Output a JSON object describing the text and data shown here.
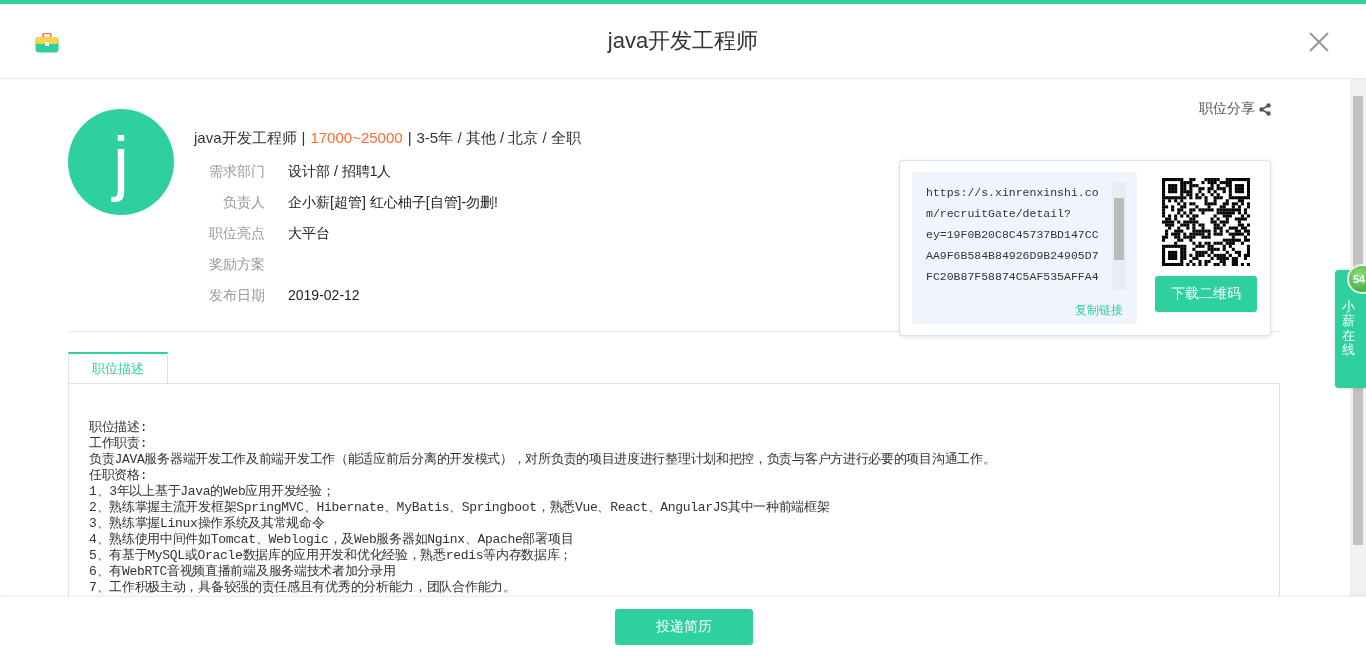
{
  "header": {
    "title": "java开发工程师"
  },
  "job": {
    "avatar_letter": "j",
    "title": "java开发工程师",
    "separator": "|",
    "salary": "17000~25000",
    "details": "3-5年 / 其他 / 北京 / 全职",
    "fields": [
      {
        "label": "需求部门",
        "value": "设计部 / 招聘1人"
      },
      {
        "label": "负责人",
        "value": "企小薪[超管] 红心柚子[自管]-勿删!"
      },
      {
        "label": "职位亮点",
        "value": "大平台"
      },
      {
        "label": "奖励方案"
      },
      {
        "label": "发布日期",
        "value": "2019-02-12"
      }
    ]
  },
  "share": {
    "label": "职位分享",
    "link_lines": [
      "https://s.xinrenxinshi.co",
      "m/recruitGate/detail?",
      "ey=19F0B20C8C45737BD147CC",
      "AA9F6B584B84926D9B24905D7",
      "FC20B87F58874C5AF535AFFA4"
    ],
    "copy_link": "复制链接",
    "download_button": "下载二维码"
  },
  "tabs": [
    {
      "label": "职位描述",
      "selected": true
    }
  ],
  "description": [
    "职位描述:",
    "工作职责:",
    "负责JAVA服务器端开发工作及前端开发工作（能适应前后分离的开发模式），对所负责的项目进度进行整理计划和把控，负责与客户方进行必要的项目沟通工作。",
    "任职资格:",
    "1、3年以上基于Java的Web应用开发经验；",
    "2、熟练掌握主流开发框架SpringMVC、Hibernate、MyBatis、Springboot，熟悉Vue、React、AngularJS其中一种前端框架",
    "3、熟练掌握Linux操作系统及其常规命令",
    "4、熟练使用中间件如Tomcat、Weblogic，及Web服务器如Nginx、Apache部署项目",
    "5、有基于MySQL或Oracle数据库的应用开发和优化经验，熟悉redis等内存数据库；",
    "6、有WebRTC音视频直播前端及服务端技术者加分录用",
    "7、工作积极主动，具备较强的责任感且有优秀的分析能力，团队合作能力。"
  ],
  "chat": {
    "badge": "54",
    "label": "小薪在线"
  },
  "footer": {
    "apply_button": "投递简历"
  }
}
